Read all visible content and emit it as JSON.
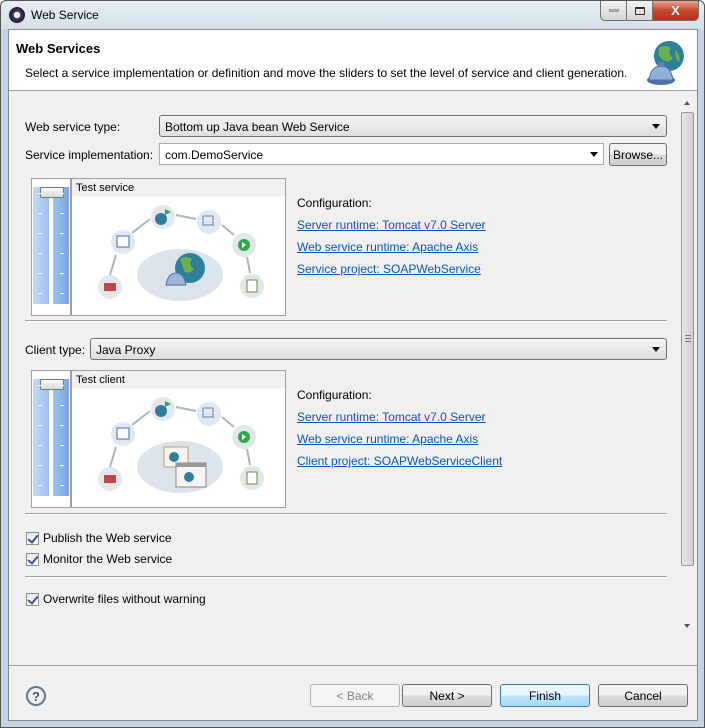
{
  "window": {
    "title": "Web Service",
    "controls": {
      "minimize": "minimize",
      "maximize": "maximize",
      "close": "X"
    }
  },
  "banner": {
    "title": "Web Services",
    "description": "Select a service implementation or definition and move the sliders to set the level of service and client generation.",
    "icon": "web-services-globe-icon"
  },
  "service": {
    "type_label": "Web service type:",
    "type_value": "Bottom up Java bean Web Service",
    "impl_label": "Service implementation:",
    "impl_value": "com.DemoService",
    "browse_label": "Browse...",
    "slider_level_label": "Test service",
    "slider_level_index": 0,
    "slider_levels_total": 6,
    "config_label": "Configuration:",
    "links": [
      "Server runtime: Tomcat v7.0 Server",
      "Web service runtime: Apache Axis",
      "Service project: SOAPWebService"
    ]
  },
  "client": {
    "type_label": "Client type:",
    "type_value": "Java Proxy",
    "slider_level_label": "Test client",
    "slider_level_index": 0,
    "slider_levels_total": 6,
    "config_label": "Configuration:",
    "links": [
      "Server runtime: Tomcat v7.0 Server",
      "Web service runtime: Apache Axis",
      "Client project: SOAPWebServiceClient"
    ]
  },
  "options": {
    "publish": {
      "label": "Publish the Web service",
      "checked": true
    },
    "monitor": {
      "label": "Monitor the Web service",
      "checked": true
    },
    "overwrite": {
      "label": "Overwrite files without warning",
      "checked": true
    }
  },
  "footer": {
    "help": "?",
    "back": "< Back",
    "next": "Next >",
    "finish": "Finish",
    "cancel": "Cancel"
  },
  "colors": {
    "link": "#0a56b8",
    "slider_blue": "#9ec0ef",
    "close_red": "#c7452d",
    "default_button": "#bee6fd"
  }
}
